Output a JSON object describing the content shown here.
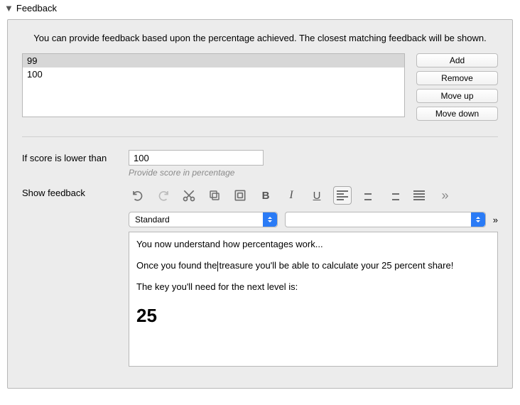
{
  "section": {
    "title": "Feedback"
  },
  "intro": "You can provide feedback based upon the percentage achieved. The closest matching feedback will be shown.",
  "thresholds": {
    "items": [
      "99",
      "100"
    ],
    "selected_index": 0
  },
  "buttons": {
    "add": "Add",
    "remove": "Remove",
    "move_up": "Move up",
    "move_down": "Move down"
  },
  "score": {
    "label": "If score is lower than",
    "value": "100",
    "hint": "Provide score in percentage"
  },
  "feedback_label": "Show feedback",
  "editor": {
    "style_select": {
      "value": "Standard"
    },
    "font_select": {
      "value": ""
    },
    "content": {
      "p1": "You now understand how percentages work...",
      "p2a": "Once you found the",
      "p2b": "treasure you'll be able to calculate your 25 percent share!",
      "p3": "The key you'll need for the next level is:",
      "big": "25"
    }
  },
  "toolbar": {
    "undo": "undo-icon",
    "redo": "redo-icon",
    "cut": "cut-icon",
    "copy": "copy-icon",
    "paste": "paste-icon",
    "bold": "B",
    "italic": "I",
    "underline": "U",
    "align_left": "align-left-icon",
    "align_center": "align-center-icon",
    "align_right": "align-right-icon",
    "align_justify": "align-justify-icon",
    "more": "»"
  }
}
